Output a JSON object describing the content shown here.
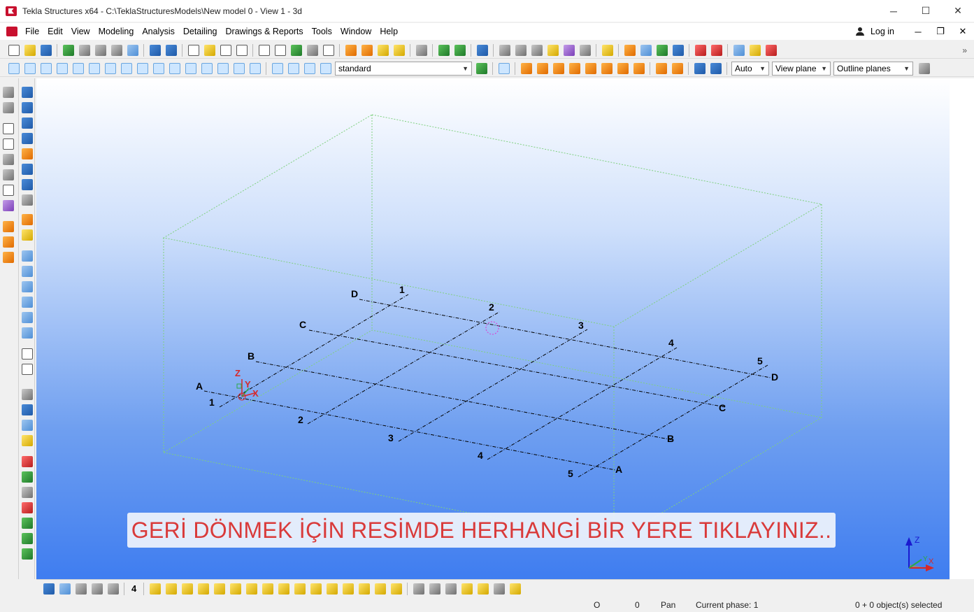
{
  "window": {
    "title": "Tekla Structures x64 - C:\\TeklaStructuresModels\\New model 0  - View 1 - 3d",
    "minimize": "─",
    "maximize": "☐",
    "close": "✕"
  },
  "menu": {
    "items": [
      "File",
      "Edit",
      "View",
      "Modeling",
      "Analysis",
      "Detailing",
      "Drawings & Reports",
      "Tools",
      "Window",
      "Help"
    ],
    "login": "Log in",
    "mdi_minimize": "─",
    "mdi_restore": "❐",
    "mdi_close": "✕"
  },
  "toolbar2": {
    "filter_value": "standard",
    "depth_mode": "Auto",
    "plane_mode": "View plane",
    "outline_mode": "Outline planes"
  },
  "viewport": {
    "grid_labels": {
      "rows": [
        "A",
        "B",
        "C",
        "D"
      ],
      "cols": [
        "1",
        "2",
        "3",
        "4",
        "5"
      ]
    },
    "axes": {
      "x": "X",
      "y": "Y",
      "z": "Z"
    },
    "colors": {
      "banner_text": "#d93a3a",
      "grid_line": "#000000",
      "work_area": "#7fd07f"
    },
    "banner": "GERİ DÖNMEK İÇİN RESİMDE HERHANGİ BİR YERE TIKLAYINIZ.."
  },
  "bottom_toolbar": {
    "number": "4"
  },
  "status": {
    "coord_o1": "O",
    "coord_o2": "0",
    "mode": "Pan",
    "phase": "Current phase: 1",
    "selection": "0 + 0 object(s) selected"
  }
}
